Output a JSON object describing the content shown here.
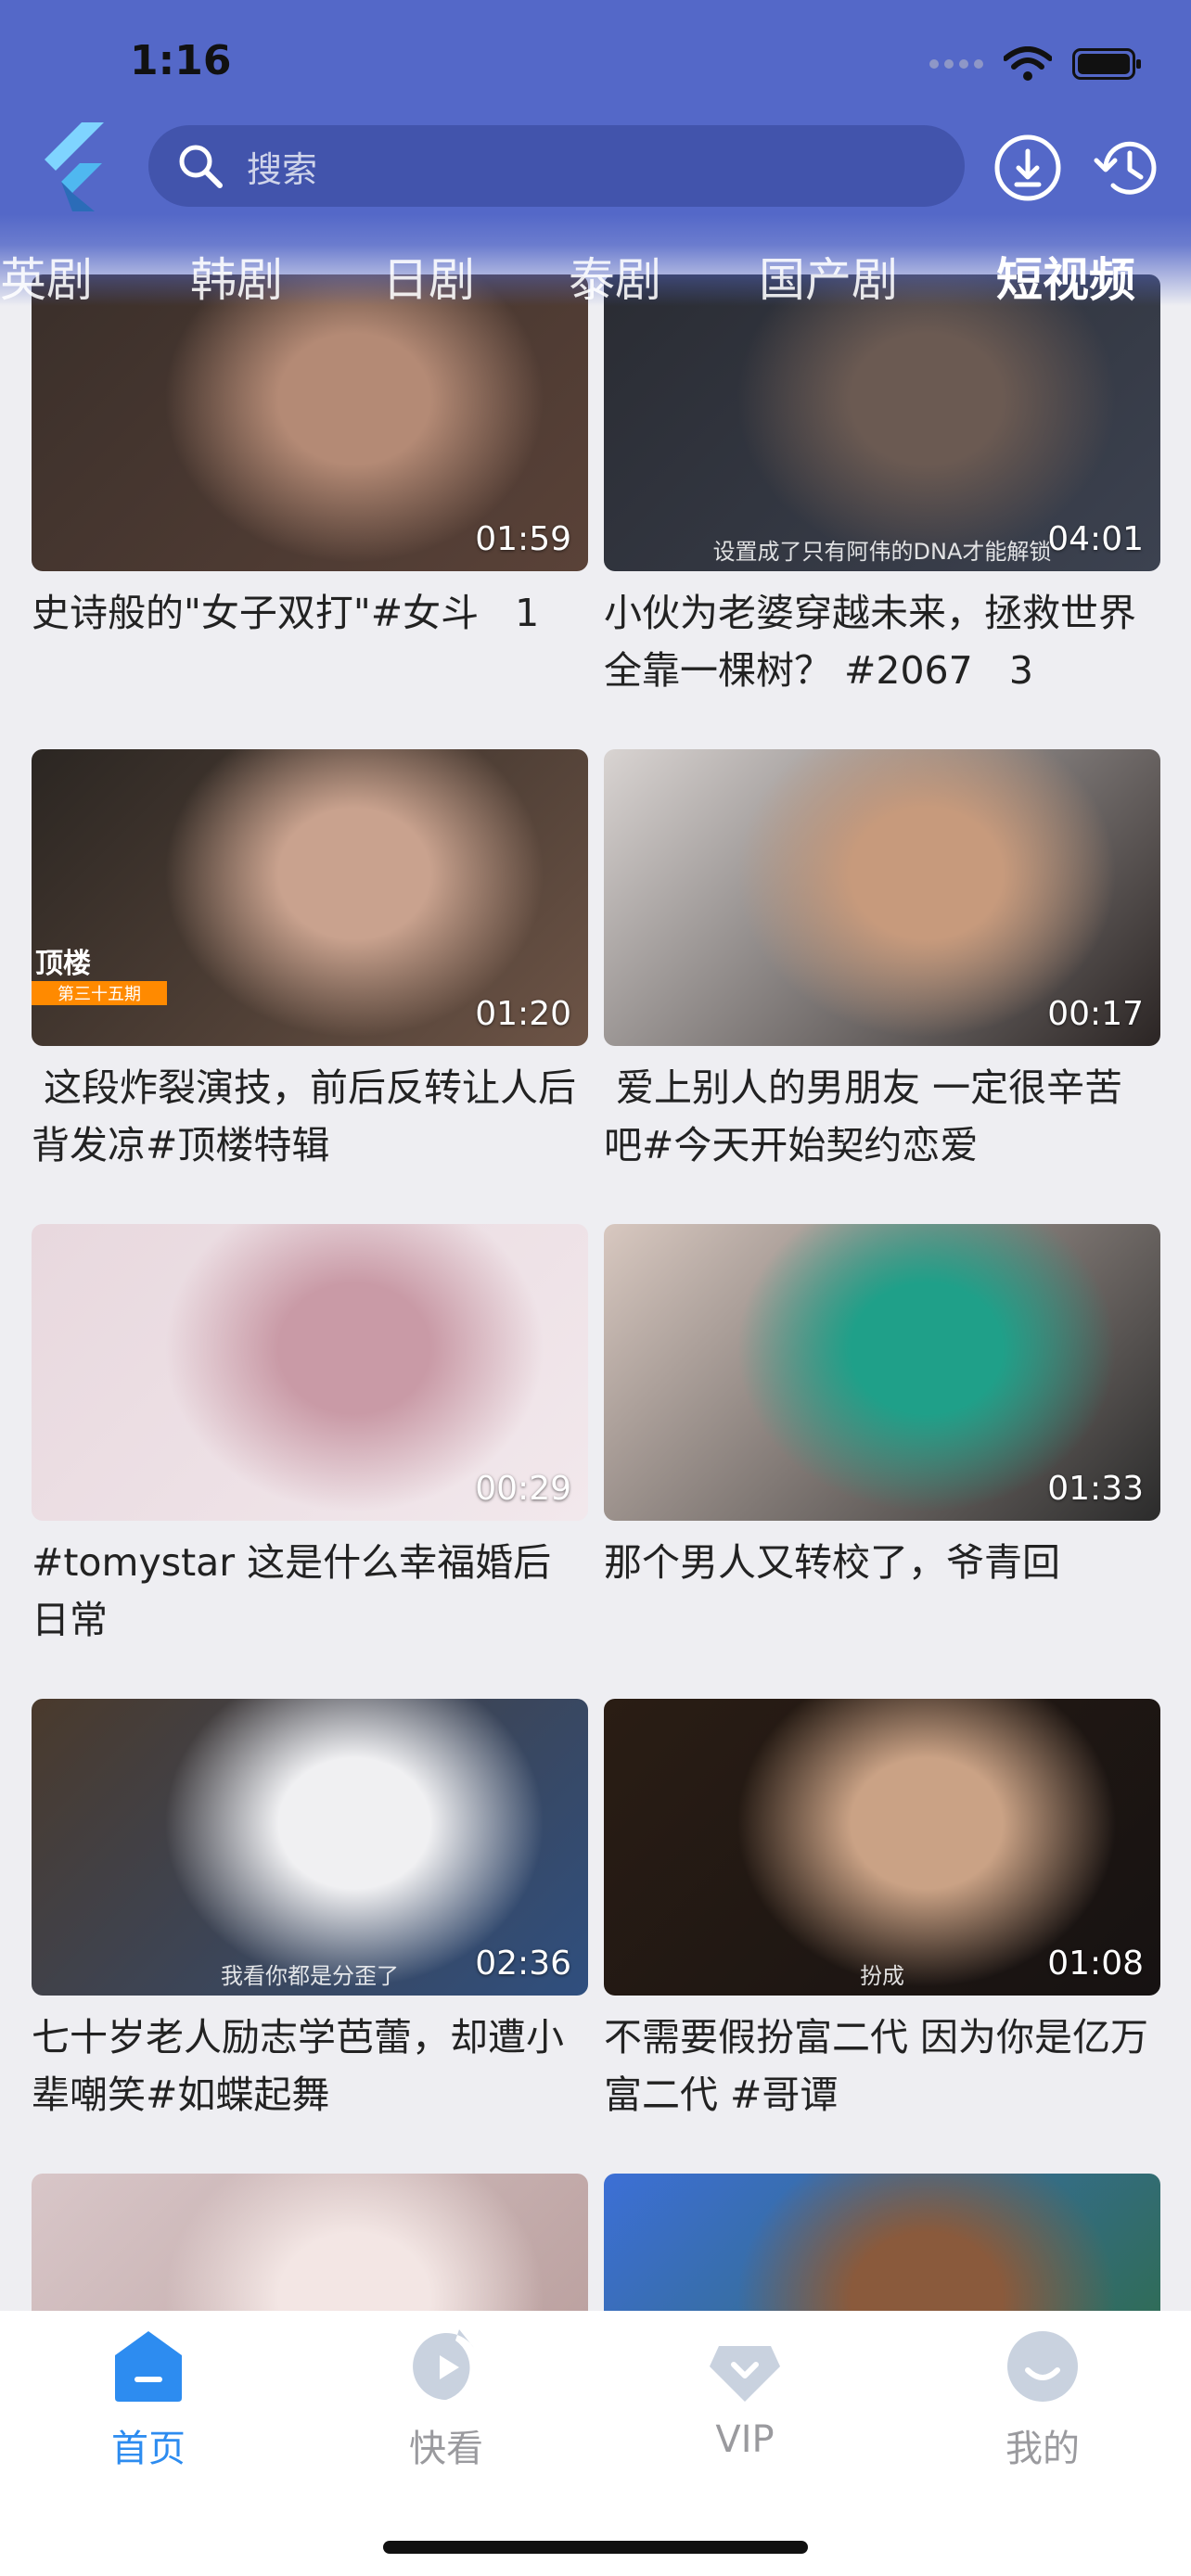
{
  "status": {
    "time": "1:16"
  },
  "search": {
    "placeholder": "搜索"
  },
  "tabs": [
    "英剧",
    "韩剧",
    "日剧",
    "泰剧",
    "国产剧",
    "短视频"
  ],
  "active_tab": "短视频",
  "videos": [
    {
      "duration": "01:59",
      "title": "史诗般的\"女子双打\"#女斗   1",
      "colors": [
        "#3a2f2a",
        "#b48a75",
        "#5a4238"
      ]
    },
    {
      "duration": "04:01",
      "title": "小伙为老婆穿越未来，拯救世界全靠一棵树？ #2067   3",
      "subtitle": "设置成了只有阿伟的DNA才能解锁",
      "colors": [
        "#2a2c33",
        "#6b5a52",
        "#3c4250"
      ]
    },
    {
      "duration": "01:20",
      "title": " 这段炸裂演技，前后反转让人后背发凉#顶楼特辑",
      "badge_title": "顶楼",
      "badge_sub": "第三十五期",
      "colors": [
        "#2b2622",
        "#c9a28e",
        "#6d5446"
      ]
    },
    {
      "duration": "00:17",
      "title": " 爱上别人的男朋友 一定很辛苦吧#今天开始契约恋爱",
      "colors": [
        "#d9d4d2",
        "#c79a7c",
        "#2b2524"
      ]
    },
    {
      "duration": "00:29",
      "title": "#tomystar 这是什么幸福婚后日常",
      "colors": [
        "#e8d8de",
        "#c99aa6",
        "#f2e8ec"
      ]
    },
    {
      "duration": "01:33",
      "title": "那个男人又转校了，爷青回",
      "colors": [
        "#d8c8c0",
        "#1fa089",
        "#2b2b2b"
      ]
    },
    {
      "duration": "02:36",
      "title": "七十岁老人励志学芭蕾，却遭小辈嘲笑#如蝶起舞",
      "subtitle": "我看你都是分歪了",
      "colors": [
        "#4a3a2c",
        "#f0f0f2",
        "#2f4f7f"
      ]
    },
    {
      "duration": "01:08",
      "title": "不需要假扮富二代 因为你是亿万富二代 #哥谭",
      "subtitle": "扮成",
      "colors": [
        "#2a1d14",
        "#caa285",
        "#161212"
      ]
    },
    {
      "duration": "",
      "title": "",
      "colors": [
        "#d8c6c8",
        "#f3e6e4",
        "#b69a98"
      ]
    },
    {
      "duration": "",
      "title": "",
      "colors": [
        "#3c6fd6",
        "#8a5a3c",
        "#2d6b3c"
      ]
    }
  ],
  "bottom_nav": [
    {
      "label": "首页",
      "icon": "home-icon",
      "active": true
    },
    {
      "label": "快看",
      "icon": "play-icon",
      "active": false
    },
    {
      "label": "VIP",
      "icon": "vip-icon",
      "active": false
    },
    {
      "label": "我的",
      "icon": "profile-icon",
      "active": false
    }
  ],
  "colors": {
    "header": "#5468c8",
    "accent": "#2d8cf0",
    "inactive": "#9a9a9e"
  }
}
